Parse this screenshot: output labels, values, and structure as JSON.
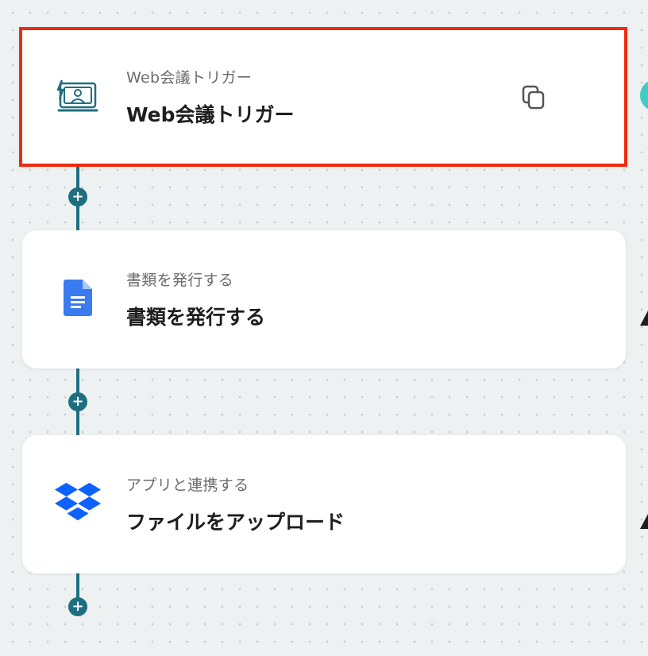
{
  "flow": {
    "steps": [
      {
        "subtitle": "Web会議トリガー",
        "title": "Web会議トリガー",
        "icon": "video-meeting-icon",
        "selected": true
      },
      {
        "subtitle": "書類を発行する",
        "title": "書類を発行する",
        "icon": "google-docs-icon",
        "selected": false
      },
      {
        "subtitle": "アプリと連携する",
        "title": "ファイルをアップロード",
        "icon": "dropbox-icon",
        "selected": false
      }
    ],
    "add_step_symbol": "+"
  },
  "colors": {
    "background": "#eef1f2",
    "connector": "#1f6e80",
    "selection_border": "#ee2a11",
    "card": "#ffffff",
    "docs_blue": "#3a7bf0",
    "dropbox_blue": "#0d61ff",
    "teal_accent": "#3ecdc9"
  }
}
